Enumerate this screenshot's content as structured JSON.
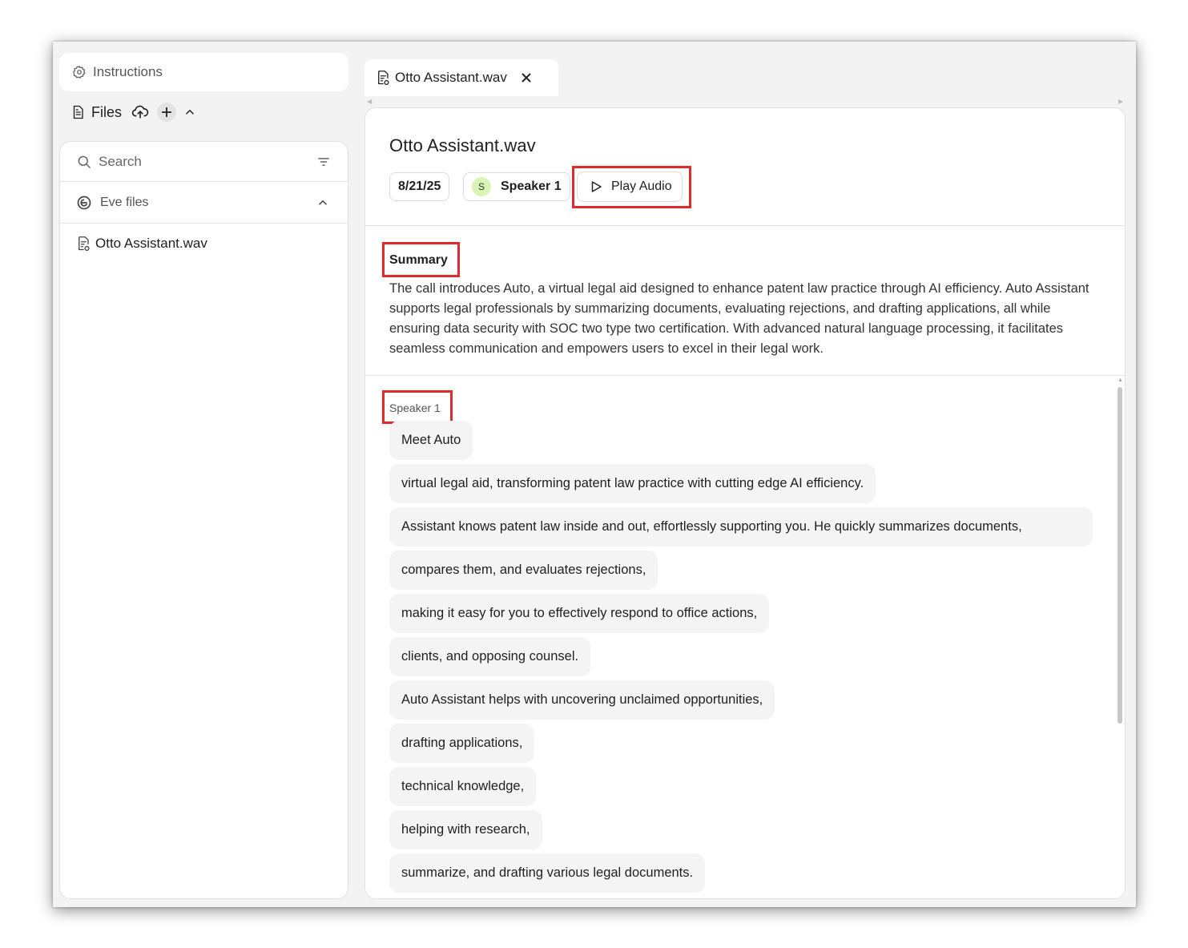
{
  "sidebar": {
    "instructions_label": "Instructions",
    "files_label": "Files",
    "search_placeholder": "Search",
    "group_label": "Eve files",
    "files": [
      {
        "name": "Otto Assistant.wav"
      }
    ]
  },
  "tab": {
    "label": "Otto Assistant.wav"
  },
  "document": {
    "title": "Otto Assistant.wav",
    "date": "8/21/25",
    "speaker_initial": "S",
    "speaker_name": "Speaker 1",
    "play_label": "Play Audio",
    "summary_title": "Summary",
    "summary_text": "The call introduces Auto, a virtual legal aid designed to enhance patent law practice through AI efficiency. Auto Assistant supports legal professionals by summarizing documents, evaluating rejections, and drafting applications, all while ensuring data security with SOC two type two certification. With advanced natural language processing, it facilitates seamless communication and empowers users to excel in their legal work.",
    "transcript_speaker": "Speaker 1",
    "segments": [
      "Meet Auto",
      "virtual legal aid, transforming patent law practice with cutting edge AI efficiency.",
      "Assistant knows patent law inside and out, effortlessly supporting you. He quickly summarizes documents,",
      "compares them, and evaluates rejections,",
      "making it easy for you to effectively respond to office actions,",
      "clients, and opposing counsel.",
      "Auto Assistant helps with uncovering unclaimed opportunities,",
      "drafting applications,",
      "technical knowledge,",
      "helping with research,",
      "summarize, and drafting various legal documents."
    ]
  },
  "colors": {
    "highlight": "#e02b2b",
    "avatar_bg": "#d9f5b5",
    "bubble_bg": "#f4f4f4"
  }
}
